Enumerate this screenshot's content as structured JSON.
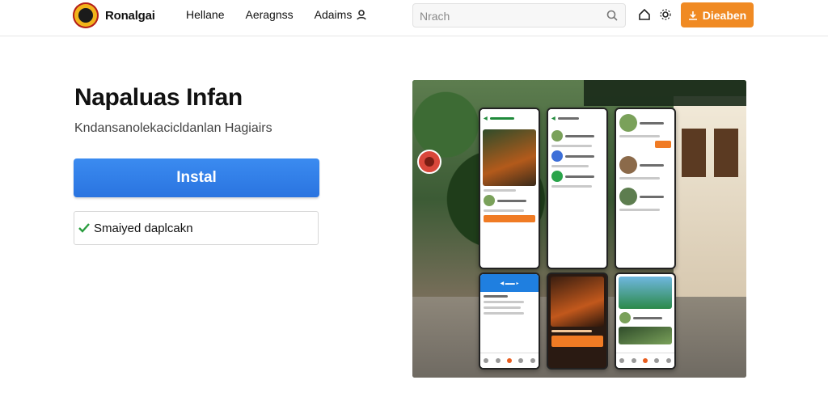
{
  "brand": {
    "name": "Ronalgai"
  },
  "nav": {
    "links": [
      "Hellane",
      "Aeragnss",
      "Adaims"
    ]
  },
  "search": {
    "placeholder": "Nrach"
  },
  "header_cta": {
    "label": "Dieaben"
  },
  "hero": {
    "title": "Napaluas Infan",
    "subtitle": "Kndansanolekacicldanlan Hagiairs",
    "install_label": "Instal",
    "verified_label": "Smaiyed daplcakn"
  },
  "colors": {
    "accent_orange": "#f08a23",
    "primary_blue": "#2a74e0",
    "check_green": "#2a9d3f"
  },
  "icons": [
    "logo",
    "user-icon",
    "search-icon",
    "home-icon",
    "settings-icon",
    "download-icon",
    "check-icon",
    "location-pin-icon"
  ]
}
